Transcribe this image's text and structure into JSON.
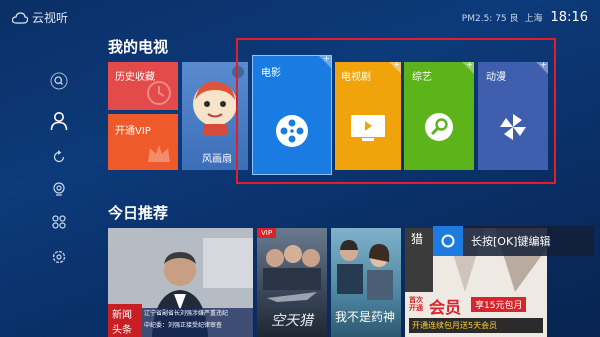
{
  "topbar": {
    "app_name": "云视听",
    "air_quality": "PM2.5: 75 良",
    "city": "上海",
    "clock": "18:16"
  },
  "sidenav": {
    "items": [
      {
        "icon": "search-icon"
      },
      {
        "icon": "user-icon"
      },
      {
        "icon": "refresh-icon"
      },
      {
        "icon": "broadcast-icon"
      },
      {
        "icon": "apps-icon"
      },
      {
        "icon": "settings-icon"
      }
    ]
  },
  "my_tv": {
    "title": "我的电视",
    "history_label": "历史收藏",
    "vip_label": "开通VIP",
    "poster_label": "风画扇",
    "categories": [
      {
        "label": "电影",
        "color": "#1a7be2"
      },
      {
        "label": "电视剧",
        "color": "#f0a30a"
      },
      {
        "label": "综艺",
        "color": "#5cb31a"
      },
      {
        "label": "动漫",
        "color": "#3f5fae"
      }
    ]
  },
  "recommend": {
    "title": "今日推荐",
    "news_tag_1": "新闻",
    "news_tag_2": "头条",
    "news_caption_1": "辽宁省副省长刘强涉嫌严重违纪",
    "news_caption_2": "中纪委：刘强正接受纪律审查",
    "vip_badge": "VIP",
    "movie1_title": "空天猎",
    "movie2_title": "我不是药神",
    "promo_text_1": "首次",
    "promo_text_2": "开通",
    "promo_text_3": "会员",
    "promo_text_4": "享15元包月",
    "promo_text_5": "开通连续包月送5天会员",
    "promo_corner": "猎"
  },
  "toast": {
    "text": "长按[OK]键编辑"
  },
  "colors": {
    "highlight_border": "#e01f2a",
    "history_tile": "#e34a4a",
    "vip_tile": "#ef5a2a"
  }
}
